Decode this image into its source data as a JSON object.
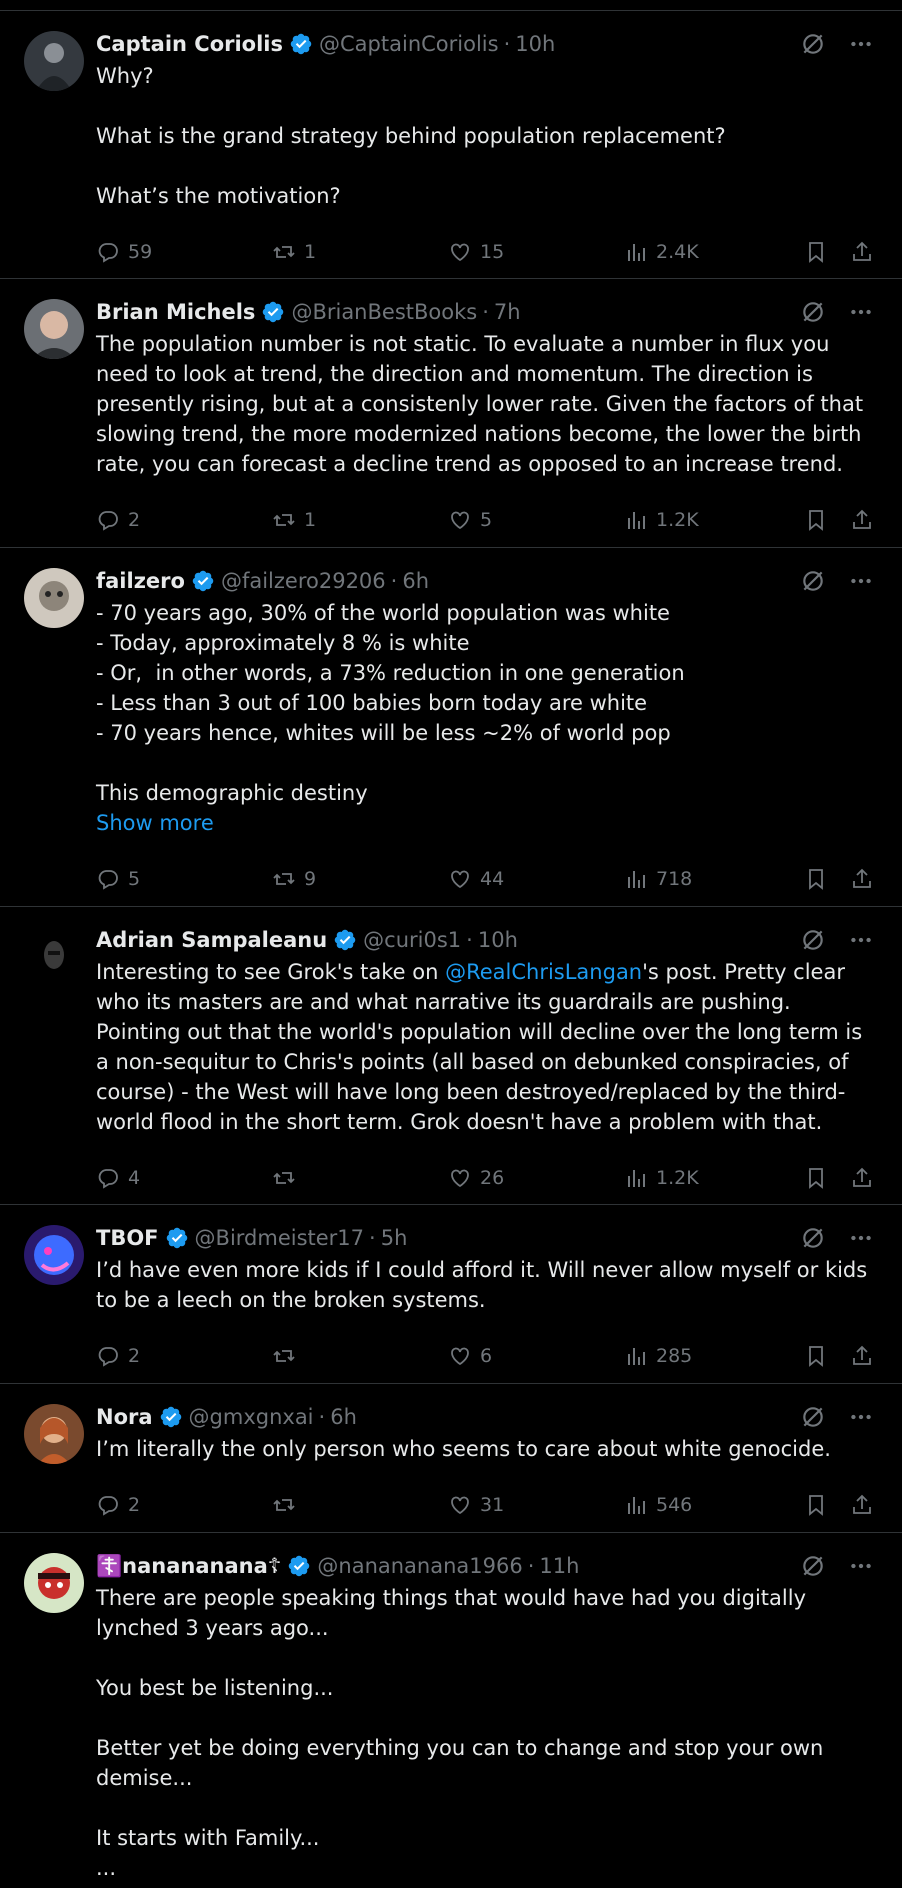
{
  "tweets": [
    {
      "name": "Captain Coriolis",
      "handle": "@CaptainCoriolis",
      "time": "10h",
      "text": "Why?\n\nWhat is the grand strategy behind population replacement?\n\nWhat’s the motivation?",
      "replies": "59",
      "retweets": "1",
      "likes": "15",
      "views": "2.4K"
    },
    {
      "name": "Brian Michels",
      "handle": "@BrianBestBooks",
      "time": "7h",
      "text": "The population number is not static. To evaluate a number in flux you need to look at trend, the direction and momentum. The direction is presently rising, but at a consistenly lower rate. Given the factors of that slowing trend, the more modernized nations become, the lower the birth rate, you can forecast a decline trend as opposed to an increase trend.",
      "replies": "2",
      "retweets": "1",
      "likes": "5",
      "views": "1.2K"
    },
    {
      "name": "failzero",
      "handle": "@failzero29206",
      "time": "6h",
      "text": "- 70 years ago, 30% of the world population was white\n- Today, approximately 8 % is white\n- Or,  in other words, a 73% reduction in one generation\n- Less than 3 out of 100 babies born today are white\n- 70 years hence, whites will be less ~2% of world pop\n\nThis demographic destiny",
      "show_more": "Show more",
      "replies": "5",
      "retweets": "9",
      "likes": "44",
      "views": "718"
    },
    {
      "name": "Adrian Sampaleanu",
      "handle": "@curi0s1",
      "time": "10h",
      "text_pre": "Interesting to see Grok's take on ",
      "mention": "@RealChrisLangan",
      "text_post": "'s post. Pretty clear who its masters are and what narrative its guardrails are pushing. Pointing out that the world's population will decline over the long term is a non-sequitur to Chris's points (all based on debunked conspiracies, of course) - the West will have long been destroyed/replaced by the third-world flood in the short term. Grok doesn't have a problem with that.",
      "replies": "4",
      "retweets": "",
      "likes": "26",
      "views": "1.2K"
    },
    {
      "name": "TBOF",
      "handle": "@Birdmeister17",
      "time": "5h",
      "text": "I’d have even more kids if I could afford it. Will never allow myself or kids to be a leech on the broken systems.",
      "replies": "2",
      "retweets": "",
      "likes": "6",
      "views": "285"
    },
    {
      "name": "Nora",
      "handle": "@gmxgnxai",
      "time": "6h",
      "text": "I’m literally the only person who seems to care about white genocide.",
      "replies": "2",
      "retweets": "",
      "likes": "31",
      "views": "546"
    },
    {
      "name": "☦️nanananana☦",
      "handle": "@nanananana1966",
      "time": "11h",
      "text": "There are people speaking things that would have had you digitally lynched 3 years ago...\n\nYou best be listening...\n\nBetter yet be doing everything you can to change and stop your own demise...\n\nIt starts with Family...\n...",
      "replies": "",
      "retweets": "",
      "likes": "",
      "views": ""
    }
  ],
  "separator": "·",
  "colors": {
    "accent": "#1d9bf0",
    "muted": "#71767b",
    "text": "#e7e9ea",
    "border": "#2f3336"
  }
}
